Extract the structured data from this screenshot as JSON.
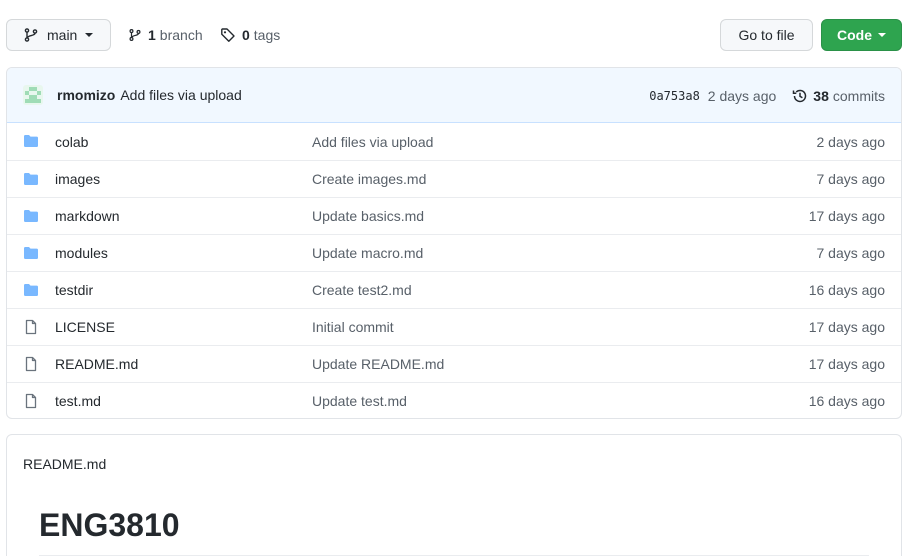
{
  "toolbar": {
    "branch_name": "main",
    "branch_count": "1",
    "branch_word": "branch",
    "tag_count": "0",
    "tag_word": "tags",
    "go_to_file_label": "Go to file",
    "code_label": "Code"
  },
  "latest_commit": {
    "author": "rmomizo",
    "message": "Add files via upload",
    "sha": "0a753a8",
    "age": "2 days ago",
    "commit_count": "38",
    "commit_word": "commits"
  },
  "files": [
    {
      "type": "folder",
      "name": "colab",
      "message": "Add files via upload",
      "age": "2 days ago"
    },
    {
      "type": "folder",
      "name": "images",
      "message": "Create images.md",
      "age": "7 days ago"
    },
    {
      "type": "folder",
      "name": "markdown",
      "message": "Update basics.md",
      "age": "17 days ago"
    },
    {
      "type": "folder",
      "name": "modules",
      "message": "Update macro.md",
      "age": "7 days ago"
    },
    {
      "type": "folder",
      "name": "testdir",
      "message": "Create test2.md",
      "age": "16 days ago"
    },
    {
      "type": "file",
      "name": "LICENSE",
      "message": "Initial commit",
      "age": "17 days ago"
    },
    {
      "type": "file",
      "name": "README.md",
      "message": "Update README.md",
      "age": "17 days ago"
    },
    {
      "type": "file",
      "name": "test.md",
      "message": "Update test.md",
      "age": "16 days ago"
    }
  ],
  "readme": {
    "filename": "README.md",
    "heading": "ENG3810"
  },
  "colors": {
    "folder_icon": "#79b8ff",
    "file_icon": "#6a737d",
    "code_button": "#2ea44f",
    "commit_bar_bg": "#f1f8ff"
  }
}
